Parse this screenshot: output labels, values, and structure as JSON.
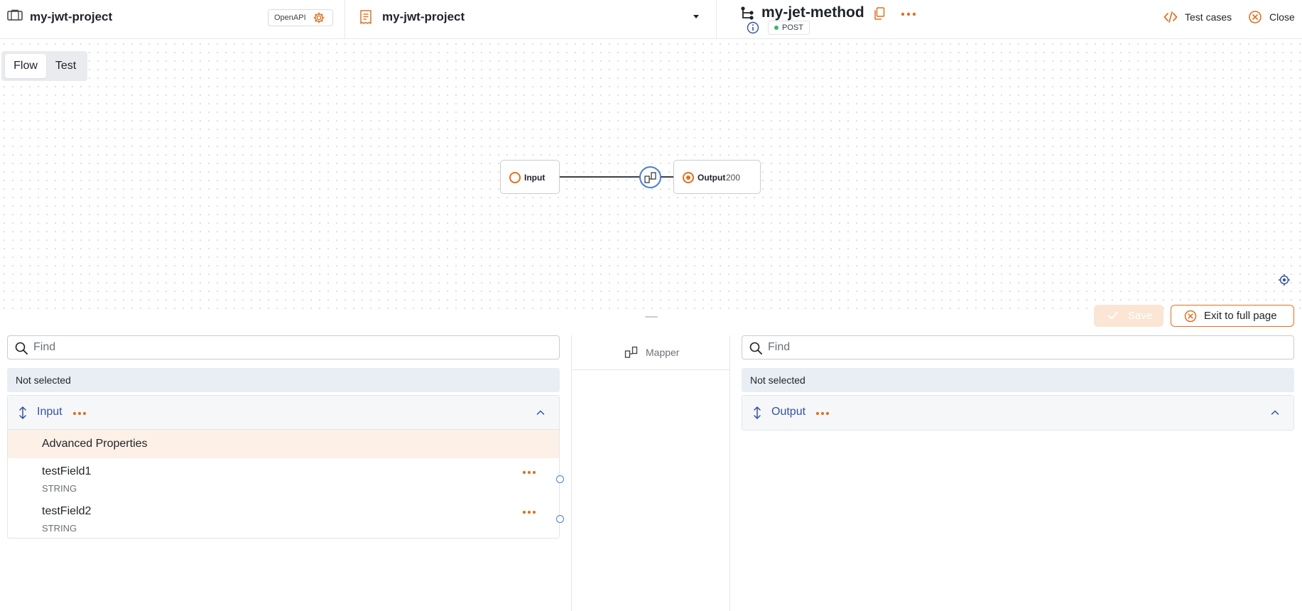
{
  "header": {
    "project": {
      "title": "my-jwt-project",
      "chip_label": "OpenAPI"
    },
    "selector": {
      "title": "my-jwt-project"
    },
    "method": {
      "title": "my-jet-method",
      "http_method": "POST"
    },
    "actions": {
      "test_cases": "Test cases",
      "close": "Close"
    }
  },
  "canvas": {
    "modes": [
      {
        "label": "Flow",
        "active": true
      },
      {
        "label": "Test",
        "active": false
      }
    ],
    "nodes": {
      "input": {
        "label": "Input"
      },
      "output": {
        "label": "Output",
        "status": "200"
      }
    }
  },
  "toolbar": {
    "save_label": "Save",
    "exit_label": "Exit to full page"
  },
  "left_panel": {
    "find_placeholder": "Find",
    "selection": "Not selected",
    "root": {
      "label": "Input"
    },
    "advanced": "Advanced Properties",
    "fields": [
      {
        "name": "testField1",
        "type": "STRING"
      },
      {
        "name": "testField2",
        "type": "STRING"
      }
    ]
  },
  "mapper": {
    "label": "Mapper"
  },
  "right_panel": {
    "find_placeholder": "Find",
    "selection": "Not selected",
    "root": {
      "label": "Output"
    }
  },
  "colors": {
    "accent": "#e07020",
    "link": "#3551a3",
    "port": "#4a7fd1",
    "success": "#3cb371"
  },
  "icons": [
    "briefcase-icon",
    "gear-icon",
    "document-icon",
    "chevron-down-icon",
    "flow-icon",
    "copy-icon",
    "more-icon",
    "info-icon",
    "code-icon",
    "close-circle-icon",
    "mapper-icon",
    "locate-icon",
    "check-icon",
    "search-icon",
    "sort-icon",
    "chevron-up-icon"
  ]
}
